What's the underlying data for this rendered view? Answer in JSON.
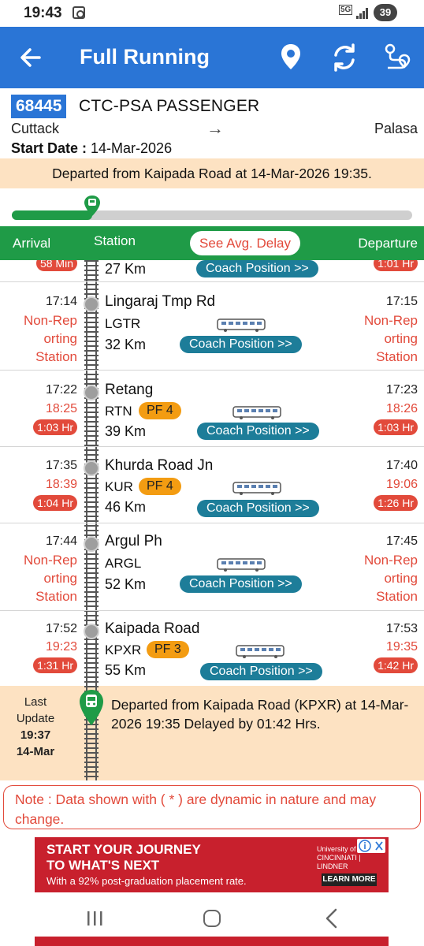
{
  "status_bar": {
    "time": "19:43",
    "network": "5G",
    "battery": "39"
  },
  "app_bar": {
    "title": "Full Running"
  },
  "train": {
    "number": "68445",
    "name": "CTC-PSA PASSENGER",
    "from": "Cuttack",
    "to": "Palasa",
    "arrow": "→",
    "start_date_label": "Start Date : ",
    "start_date": "14-Mar-2026"
  },
  "banner": "Departed from Kaipada Road at 14-Mar-2026 19:35.",
  "progress": {
    "fraction": 0.2
  },
  "columns": {
    "arrival": "Arrival",
    "station": "Station",
    "avg_delay": "See Avg. Delay",
    "departure": "Departure"
  },
  "partial_row": {
    "arr_delay": "58 Min",
    "km": "27 Km",
    "coach": "Coach Position >>",
    "dep_delay": "1:01 Hr"
  },
  "stations": [
    {
      "arr_sched": "17:14",
      "arr_status": "Non-Rep orting Station",
      "name": "Lingaraj Tmp Rd",
      "code": "LGTR",
      "km": "32 Km",
      "coach": "Coach Position >>",
      "dep_sched": "17:15",
      "dep_status": "Non-Rep orting Station"
    },
    {
      "arr_sched": "17:22",
      "arr_actual": "18:25",
      "arr_delay": "1:03 Hr",
      "name": "Retang",
      "code": "RTN",
      "pf": "PF 4",
      "km": "39 Km",
      "coach": "Coach Position >>",
      "dep_sched": "17:23",
      "dep_actual": "18:26",
      "dep_delay": "1:03 Hr"
    },
    {
      "arr_sched": "17:35",
      "arr_actual": "18:39",
      "arr_delay": "1:04 Hr",
      "name": "Khurda Road Jn",
      "code": "KUR",
      "pf": "PF 4",
      "km": "46 Km",
      "coach": "Coach Position >>",
      "dep_sched": "17:40",
      "dep_actual": "19:06",
      "dep_delay": "1:26 Hr"
    },
    {
      "arr_sched": "17:44",
      "arr_status": "Non-Rep orting Station",
      "name": "Argul Ph",
      "code": "ARGL",
      "km": "52 Km",
      "coach": "Coach Position >>",
      "dep_sched": "17:45",
      "dep_status": "Non-Rep orting Station"
    },
    {
      "arr_sched": "17:52",
      "arr_actual": "19:23",
      "arr_delay": "1:31 Hr",
      "name": "Kaipada Road",
      "code": "KPXR",
      "pf": "PF 3",
      "km": "55 Km",
      "coach": "Coach Position >>",
      "dep_sched": "17:53",
      "dep_actual": "19:35",
      "dep_delay": "1:42 Hr"
    }
  ],
  "last_update": {
    "label_1": "Last",
    "label_2": "Update",
    "time": "19:37",
    "date": "14-Mar",
    "message": "Departed from Kaipada Road (KPXR) at 14-Mar-2026 19:35 Delayed by 01:42 Hrs."
  },
  "note": "Note : Data shown with ( * ) are dynamic in nature and may change.",
  "ad": {
    "line1": "START YOUR JOURNEY",
    "line2": "TO WHAT'S NEXT",
    "line3": "With a 92% post-graduation placement rate.",
    "logo": "University of CINCINNATI | LINDNER",
    "cta": "LEARN MORE"
  },
  "colors": {
    "primary": "#2a75d6",
    "green": "#1f9b47",
    "red": "#e24a3b",
    "banner": "#fde2c2",
    "coach": "#1d7d99",
    "pf": "#f39c12"
  }
}
